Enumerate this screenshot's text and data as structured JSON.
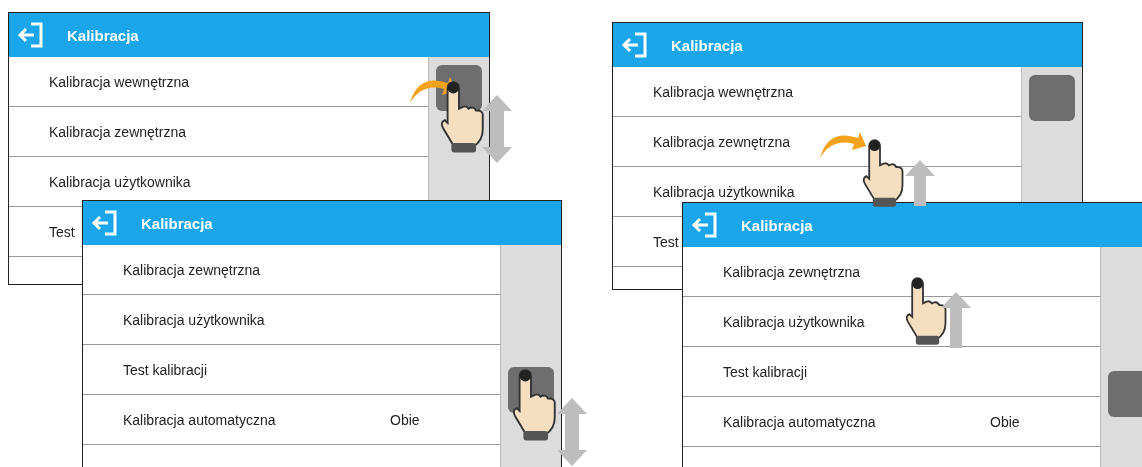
{
  "screens": [
    {
      "title": "Kalibracja",
      "rows": [
        {
          "label": "Kalibracja wewnętrzna"
        },
        {
          "label": "Kalibracja zewnętrzna"
        },
        {
          "label": "Kalibracja użytkownika"
        },
        {
          "label": "Test"
        }
      ]
    },
    {
      "title": "Kalibracja",
      "rows": [
        {
          "label": "Kalibracja zewnętrzna"
        },
        {
          "label": "Kalibracja użytkownika"
        },
        {
          "label": "Test kalibracji"
        },
        {
          "label": "Kalibracja automatyczna",
          "value": "Obie"
        }
      ]
    },
    {
      "title": "Kalibracja",
      "rows": [
        {
          "label": "Kalibracja wewnętrzna"
        },
        {
          "label": "Kalibracja zewnętrzna"
        },
        {
          "label": "Kalibracja użytkownika"
        },
        {
          "label": "Test"
        }
      ]
    },
    {
      "title": "Kalibracja",
      "rows": [
        {
          "label": "Kalibracja zewnętrzna"
        },
        {
          "label": "Kalibracja użytkownika"
        },
        {
          "label": "Test kalibracji"
        },
        {
          "label": "Kalibracja automatyczna",
          "value": "Obie"
        }
      ]
    }
  ]
}
